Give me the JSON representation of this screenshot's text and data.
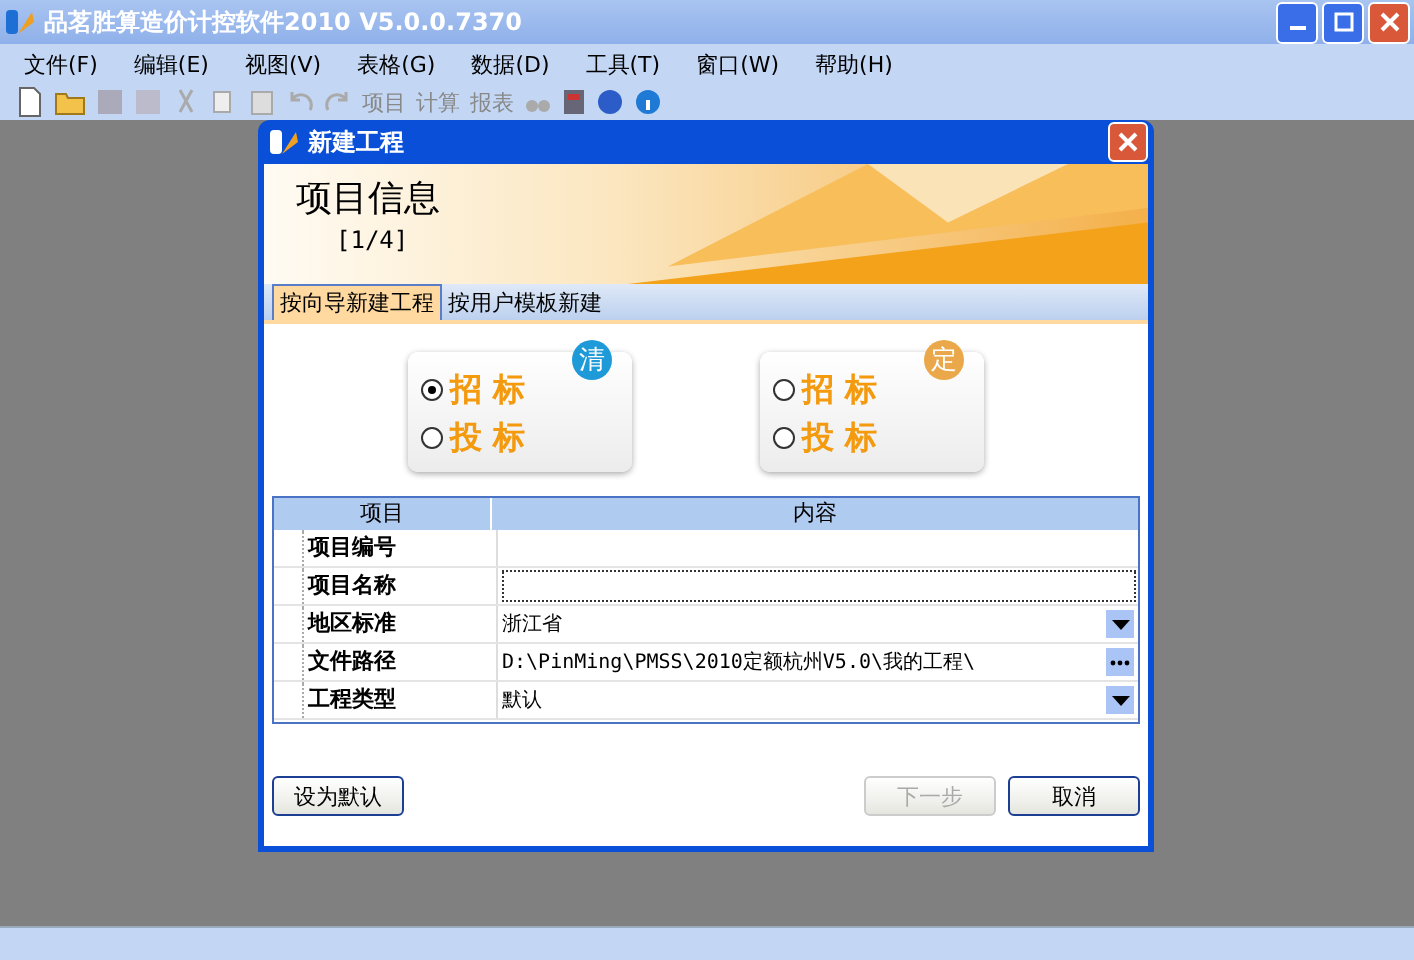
{
  "window": {
    "title": "品茗胜算造价计控软件2010 V5.0.0.7370"
  },
  "menu": [
    "文件(F)",
    "编辑(E)",
    "视图(V)",
    "表格(G)",
    "数据(D)",
    "工具(T)",
    "窗口(W)",
    "帮助(H)"
  ],
  "toolbar": {
    "buttons": [
      {
        "label": "项目"
      },
      {
        "label": "计算"
      },
      {
        "label": "报表"
      }
    ]
  },
  "dialog": {
    "title": "新建工程",
    "heading": "项目信息",
    "step": "[1/4]",
    "tabs": [
      {
        "label": "按向导新建工程",
        "selected": true
      },
      {
        "label": "按用户模板新建",
        "selected": false
      }
    ],
    "cards": [
      {
        "badge": "清",
        "color": "#1e9ad8",
        "options": [
          {
            "label": "招 标",
            "selected": true
          },
          {
            "label": "投 标",
            "selected": false
          }
        ]
      },
      {
        "badge": "定",
        "color": "#eaa84a",
        "options": [
          {
            "label": "招 标",
            "selected": false
          },
          {
            "label": "投 标",
            "selected": false
          }
        ]
      }
    ],
    "table": {
      "columns": [
        "项目",
        "内容"
      ],
      "rows": [
        {
          "label": "项目编号",
          "kind": "text"
        },
        {
          "label": "项目名称",
          "kind": "input"
        },
        {
          "label": "地区标准",
          "kind": "dropdown",
          "value": "浙江省"
        },
        {
          "label": "文件路径",
          "kind": "browse",
          "value": "D:\\PinMing\\PMSS\\2010定额杭州V5.0\\我的工程\\"
        },
        {
          "label": "工程类型",
          "kind": "dropdown",
          "value": "默认"
        }
      ]
    },
    "buttons": [
      {
        "label": "设为默认",
        "disabled": false
      },
      {
        "label": "下一步",
        "disabled": true
      },
      {
        "label": "取消",
        "disabled": false
      }
    ]
  }
}
